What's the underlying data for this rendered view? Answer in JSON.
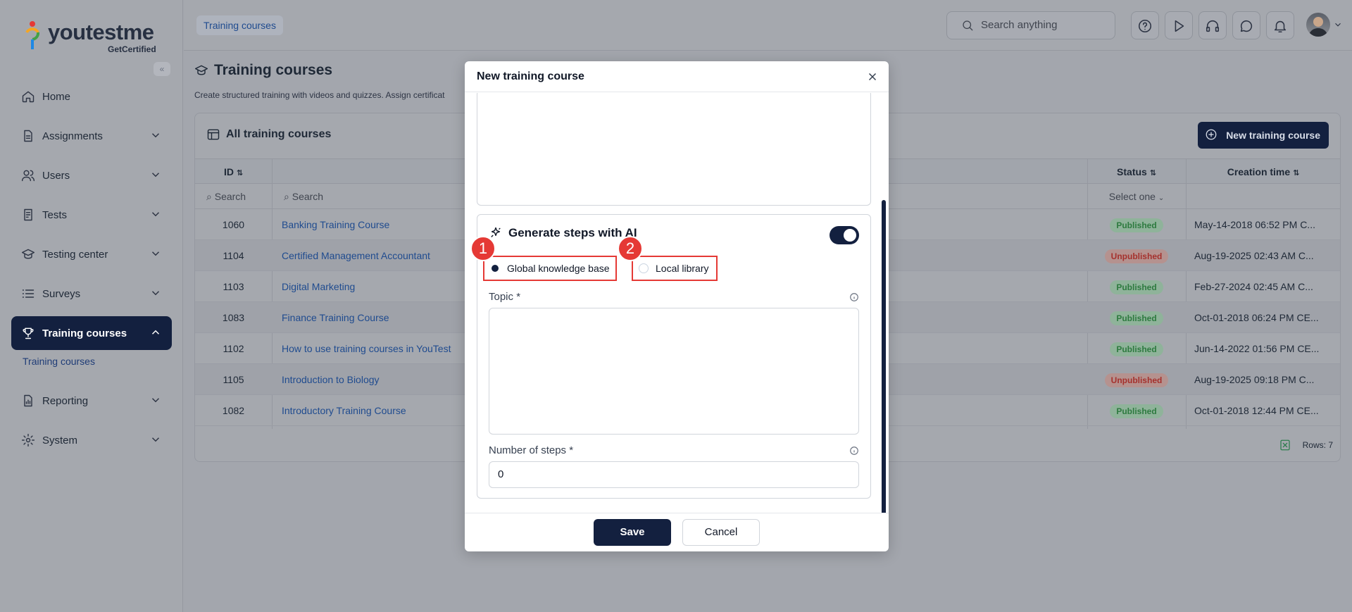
{
  "logo": {
    "text": "youtestme",
    "sub": "GetCertified"
  },
  "sidebar": {
    "items": [
      {
        "label": "Home",
        "icon": "home-icon"
      },
      {
        "label": "Assignments",
        "icon": "document-icon"
      },
      {
        "label": "Users",
        "icon": "users-icon"
      },
      {
        "label": "Tests",
        "icon": "test-icon"
      },
      {
        "label": "Testing center",
        "icon": "graduation-cap-icon"
      },
      {
        "label": "Surveys",
        "icon": "list-icon"
      },
      {
        "label": "Training courses",
        "icon": "trophy-icon"
      },
      {
        "label": "Reporting",
        "icon": "report-icon"
      },
      {
        "label": "System",
        "icon": "gear-icon"
      }
    ],
    "sub_item": "Training courses"
  },
  "header": {
    "breadcrumb": "Training courses",
    "search_placeholder": "Search anything"
  },
  "page": {
    "title": "Training courses",
    "description": "Create structured training with videos and quizzes. Assign certificat"
  },
  "table": {
    "card_title": "All training courses",
    "new_button": "New training course",
    "columns": {
      "id": "ID",
      "status": "Status",
      "creation": "Creation time"
    },
    "filters": {
      "id": "Search",
      "name": "Search",
      "status": "Select one"
    },
    "rows": [
      {
        "id": "1060",
        "name": "Banking Training Course",
        "status": "Published",
        "created": "May-14-2018 06:52 PM C..."
      },
      {
        "id": "1104",
        "name": "Certified Management Accountant",
        "status": "Unpublished",
        "created": "Aug-19-2025 02:43 AM C..."
      },
      {
        "id": "1103",
        "name": "Digital Marketing",
        "status": "Published",
        "created": "Feb-27-2024 02:45 AM C..."
      },
      {
        "id": "1083",
        "name": "Finance Training Course",
        "status": "Published",
        "created": "Oct-01-2018 06:24 PM CE..."
      },
      {
        "id": "1102",
        "name": "How to use training courses in YouTest",
        "status": "Published",
        "created": "Jun-14-2022 01:56 PM CE..."
      },
      {
        "id": "1105",
        "name": "Introduction to Biology",
        "status": "Unpublished",
        "created": "Aug-19-2025 09:18 PM C..."
      },
      {
        "id": "1082",
        "name": "Introductory Training Course",
        "status": "Published",
        "created": "Oct-01-2018 12:44 PM CE..."
      }
    ],
    "rows_count": "Rows: 7"
  },
  "modal": {
    "title": "New training course",
    "ai_title": "Generate steps with AI",
    "ai_enabled": true,
    "radio_global": "Global knowledge base",
    "radio_local": "Local library",
    "marker1": "1",
    "marker2": "2",
    "topic_label": "Topic",
    "steps_label": "Number of steps",
    "required_mark": "*",
    "steps_value": "0",
    "save": "Save",
    "cancel": "Cancel"
  },
  "colors": {
    "navy": "#13203f",
    "published": "#2d7a3f",
    "unpublished": "#a5312d",
    "highlight": "#e53935"
  }
}
